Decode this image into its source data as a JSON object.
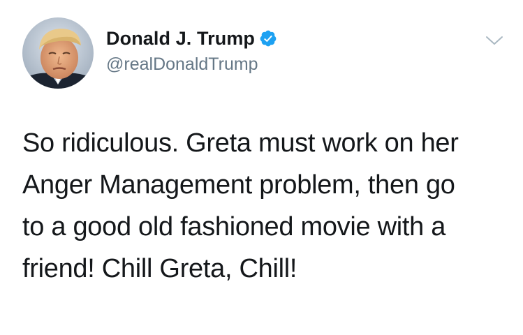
{
  "author": {
    "display_name": "Donald J. Trump",
    "handle": "@realDonaldTrump",
    "verified": true,
    "avatar_icon": "profile-photo"
  },
  "tweet": {
    "lines": [
      "So ridiculous. Greta must work on her",
      "Anger Management problem, then go",
      "to a good old fashioned movie with a",
      "friend! Chill Greta, Chill!"
    ]
  },
  "icons": {
    "verified": "verified-badge-icon",
    "menu": "chevron-down-icon"
  },
  "colors": {
    "text": "#14171a",
    "handle": "#657786",
    "verified_badge": "#1da1f2",
    "caret": "#aab8c2"
  }
}
